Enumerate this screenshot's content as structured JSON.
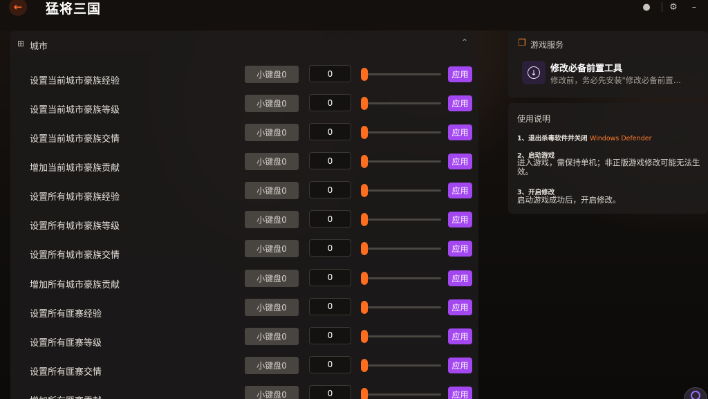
{
  "app": {
    "title": "猛将三国",
    "back_icon": "←"
  },
  "window_controls": {
    "profile_icon": "●",
    "settings_icon": "⚙",
    "minimize_icon": "–"
  },
  "section": {
    "icon": "⊞",
    "title": "城市",
    "collapse_icon": "⌃"
  },
  "rows": [
    {
      "label": "设置当前城市豪族经验",
      "hotkey": "小键盘0",
      "value": "0",
      "apply": "应用",
      "slider_value": 0
    },
    {
      "label": "设置当前城市豪族等级",
      "hotkey": "小键盘0",
      "value": "0",
      "apply": "应用",
      "slider_value": 0
    },
    {
      "label": "设置当前城市豪族交情",
      "hotkey": "小键盘0",
      "value": "0",
      "apply": "应用",
      "slider_value": 0
    },
    {
      "label": "增加当前城市豪族贡献",
      "hotkey": "小键盘0",
      "value": "0",
      "apply": "应用",
      "slider_value": 0
    },
    {
      "label": "设置所有城市豪族经验",
      "hotkey": "小键盘0",
      "value": "0",
      "apply": "应用",
      "slider_value": 0
    },
    {
      "label": "设置所有城市豪族等级",
      "hotkey": "小键盘0",
      "value": "0",
      "apply": "应用",
      "slider_value": 0
    },
    {
      "label": "设置所有城市豪族交情",
      "hotkey": "小键盘0",
      "value": "0",
      "apply": "应用",
      "slider_value": 0
    },
    {
      "label": "增加所有城市豪族贡献",
      "hotkey": "小键盘0",
      "value": "0",
      "apply": "应用",
      "slider_value": 0
    },
    {
      "label": "设置所有匪寨经验",
      "hotkey": "小键盘0",
      "value": "0",
      "apply": "应用",
      "slider_value": 0
    },
    {
      "label": "设置所有匪寨等级",
      "hotkey": "小键盘0",
      "value": "0",
      "apply": "应用",
      "slider_value": 0
    },
    {
      "label": "设置所有匪寨交情",
      "hotkey": "小键盘0",
      "value": "0",
      "apply": "应用",
      "slider_value": 0
    },
    {
      "label": "增加所有匪寨贡献",
      "hotkey": "小键盘0",
      "value": "0",
      "apply": "应用",
      "slider_value": 0
    }
  ],
  "service": {
    "icon": "❒",
    "title": "游戏服务",
    "tool_icon": "↓",
    "tool_name": "修改必备前置工具",
    "tool_desc": "修改前，务必先安装\"修改必备前置..."
  },
  "instructions": {
    "title": "使用说明",
    "step1_title": "1、退出杀毒软件并关闭",
    "step1_accent": "Windows Defender",
    "step2_title": "2、启动游戏",
    "step2_text": "进入游戏，需保持单机；非正版游戏修改可能无法生效。",
    "step3_title": "3、开启修改",
    "step3_text": "启动游戏成功后，开启修改。"
  },
  "colors": {
    "accent_orange": "#ff6d1f",
    "apply_purple": "#a347f0"
  }
}
